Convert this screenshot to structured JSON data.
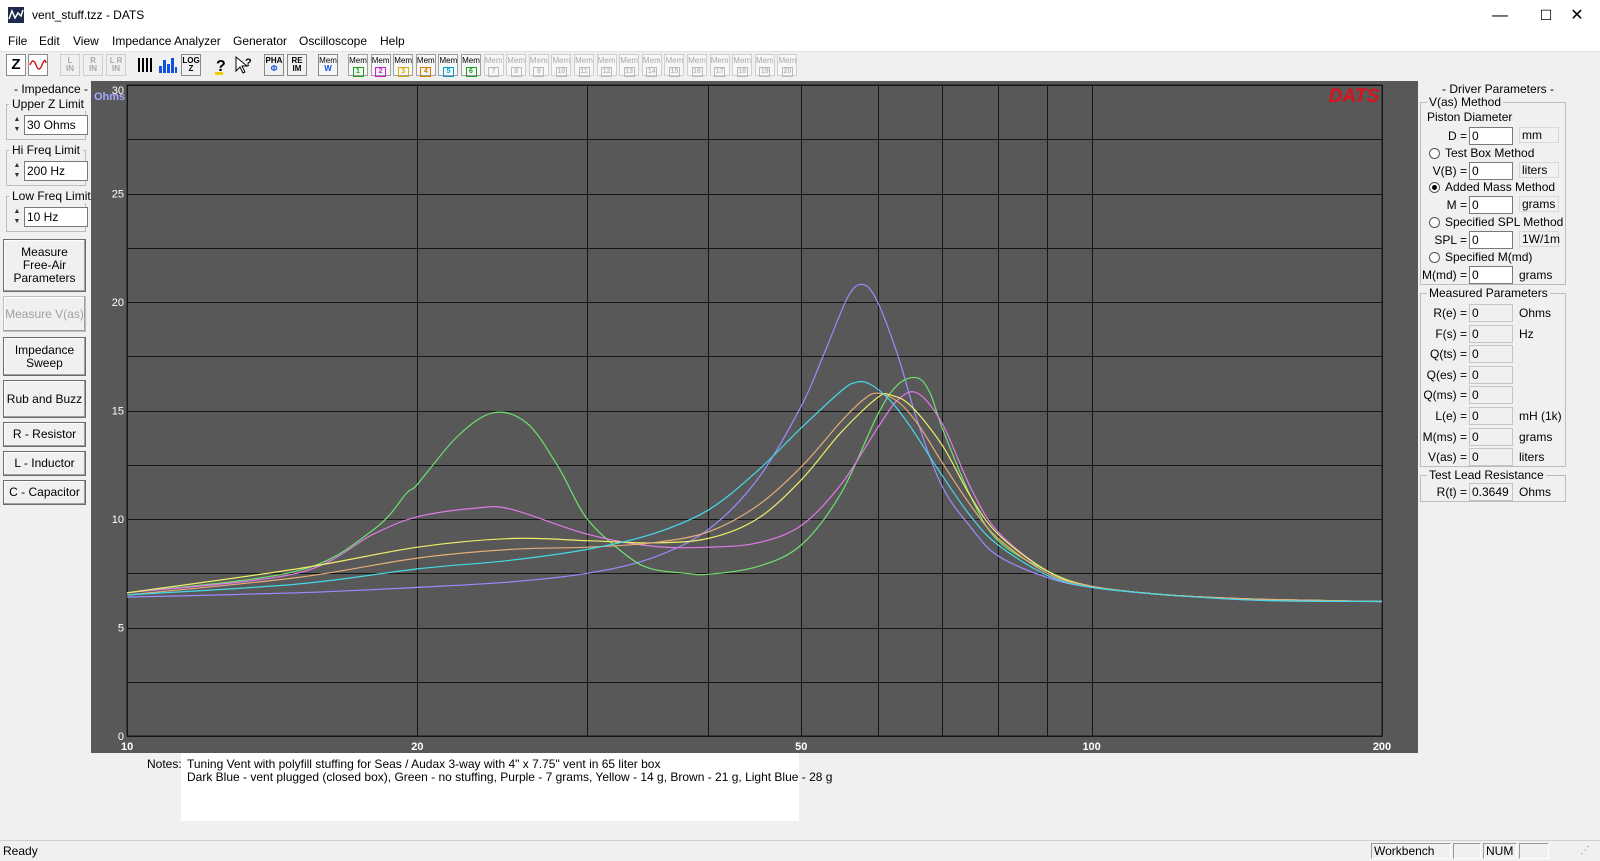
{
  "window": {
    "title": "vent_stuff.tzz - DATS",
    "minimize": "—",
    "maximize": "☐",
    "close": "✕"
  },
  "menu": [
    "File",
    "Edit",
    "View",
    "Impedance Analyzer",
    "Generator",
    "Oscilloscope",
    "Help"
  ],
  "toolbar": {
    "z_label": "Z",
    "lin_label": [
      "L",
      "IN"
    ],
    "rin_label": [
      "R",
      "IN"
    ],
    "lrin_label": [
      "L R",
      "IN"
    ],
    "log_label": [
      "LOG",
      "Z"
    ],
    "pha_label": [
      "PHA",
      "Φ"
    ],
    "reim_label": [
      "RE",
      "IM"
    ],
    "memw_label": [
      "Mem",
      "W"
    ],
    "mem_word": "Mem",
    "mem_slots": [
      {
        "n": "1",
        "color": "#1ea21e",
        "enabled": true
      },
      {
        "n": "2",
        "color": "#d01ad0",
        "enabled": true
      },
      {
        "n": "3",
        "color": "#d8b000",
        "enabled": true
      },
      {
        "n": "4",
        "color": "#d87a00",
        "enabled": true
      },
      {
        "n": "5",
        "color": "#00a0d0",
        "enabled": true
      },
      {
        "n": "6",
        "color": "#1ea21e",
        "enabled": true
      },
      {
        "n": "7",
        "enabled": false
      },
      {
        "n": "8",
        "enabled": false
      },
      {
        "n": "9",
        "enabled": false
      },
      {
        "n": "10",
        "enabled": false
      },
      {
        "n": "11",
        "enabled": false
      },
      {
        "n": "12",
        "enabled": false
      },
      {
        "n": "13",
        "enabled": false
      },
      {
        "n": "14",
        "enabled": false
      },
      {
        "n": "15",
        "enabled": false
      },
      {
        "n": "16",
        "enabled": false
      },
      {
        "n": "17",
        "enabled": false
      },
      {
        "n": "18",
        "enabled": false
      },
      {
        "n": "19",
        "enabled": false
      },
      {
        "n": "20",
        "enabled": false
      }
    ]
  },
  "left": {
    "impedance_group": "- Impedance -",
    "upper_z_label": "Upper Z Limit",
    "upper_z_value": "30 Ohms",
    "hi_freq_label": "Hi Freq Limit",
    "hi_freq_value": "200 Hz",
    "low_freq_label": "Low Freq Limit",
    "low_freq_value": "10 Hz",
    "btn_measure_free_air": [
      "Measure",
      "Free-Air",
      "Parameters"
    ],
    "btn_measure_vas": "Measure V(as)",
    "btn_impedance_sweep": [
      "Impedance",
      "Sweep"
    ],
    "btn_rub_buzz": "Rub and Buzz",
    "btn_resistor": "R - Resistor",
    "btn_inductor": "L - Inductor",
    "btn_capacitor": "C - Capacitor"
  },
  "chart_data": {
    "type": "line",
    "ylabel": "Ohms",
    "watermark": "DATS",
    "x_scale": "log",
    "xlim": [
      10,
      200
    ],
    "ylim": [
      0,
      30
    ],
    "x_ticks": [
      10,
      20,
      50,
      100,
      200
    ],
    "x_grid": [
      10,
      20,
      30,
      40,
      50,
      60,
      70,
      80,
      90,
      100,
      200
    ],
    "y_ticks": [
      0,
      5,
      10,
      15,
      20,
      25,
      30
    ],
    "y_grid_step": 2.5,
    "background": "#585858",
    "grid": true,
    "series": [
      {
        "color": "#9b8cff",
        "x": [
          10,
          15,
          20,
          25,
          30,
          35,
          40,
          45,
          50,
          53,
          56,
          58,
          60,
          63,
          66,
          70,
          75,
          80,
          90,
          100,
          120,
          150,
          200
        ],
        "y": [
          6.4,
          6.6,
          6.85,
          7.1,
          7.5,
          8.2,
          9.5,
          11.8,
          15.2,
          17.8,
          20.3,
          20.8,
          20.0,
          17.5,
          14.5,
          11.5,
          9.6,
          8.3,
          7.3,
          6.85,
          6.5,
          6.25,
          6.2
        ]
      },
      {
        "color": "#6fe06f",
        "x": [
          10,
          15,
          18,
          19.5,
          20,
          22,
          24,
          26,
          28,
          30,
          33,
          35,
          38,
          40,
          45,
          50,
          55,
          60,
          63,
          66,
          68,
          70,
          75,
          80,
          90,
          100,
          120,
          150,
          200
        ],
        "y": [
          6.6,
          7.6,
          9.5,
          11.2,
          11.6,
          13.8,
          14.9,
          14.4,
          12.4,
          10.0,
          8.3,
          7.7,
          7.5,
          7.45,
          7.8,
          8.8,
          11.2,
          14.8,
          16.2,
          16.5,
          15.8,
          14.2,
          11.0,
          9.0,
          7.6,
          6.9,
          6.5,
          6.3,
          6.2
        ]
      },
      {
        "color": "#e07ae8",
        "x": [
          10,
          15,
          18,
          20,
          23,
          25,
          30,
          35,
          40,
          45,
          50,
          55,
          60,
          63,
          66,
          70,
          75,
          80,
          90,
          100,
          120,
          150,
          200
        ],
        "y": [
          6.6,
          7.5,
          9.3,
          10.1,
          10.5,
          10.45,
          9.3,
          8.75,
          8.7,
          8.9,
          9.7,
          11.6,
          14.2,
          15.5,
          15.8,
          14.4,
          11.4,
          9.4,
          7.6,
          6.9,
          6.5,
          6.3,
          6.2
        ]
      },
      {
        "color": "#eded6a",
        "x": [
          10,
          15,
          20,
          25,
          30,
          35,
          40,
          45,
          50,
          55,
          60,
          62,
          65,
          70,
          75,
          80,
          90,
          100,
          120,
          150,
          200
        ],
        "y": [
          6.6,
          7.7,
          8.7,
          9.1,
          9.0,
          8.9,
          9.1,
          10.0,
          11.8,
          14.0,
          15.6,
          15.7,
          15.2,
          13.4,
          11.0,
          9.3,
          7.6,
          6.9,
          6.5,
          6.3,
          6.2
        ]
      },
      {
        "color": "#e2ad7a",
        "x": [
          10,
          15,
          20,
          25,
          30,
          35,
          40,
          45,
          50,
          55,
          58,
          60,
          63,
          66,
          70,
          75,
          80,
          90,
          100,
          120,
          150,
          200
        ],
        "y": [
          6.5,
          7.3,
          8.2,
          8.6,
          8.7,
          8.9,
          9.4,
          10.6,
          12.4,
          14.5,
          15.5,
          15.8,
          15.4,
          14.4,
          12.6,
          10.6,
          9.1,
          7.5,
          6.9,
          6.5,
          6.3,
          6.2
        ]
      },
      {
        "color": "#46d8e8",
        "x": [
          10,
          15,
          20,
          25,
          30,
          35,
          40,
          45,
          50,
          55,
          57,
          59,
          62,
          65,
          70,
          75,
          80,
          90,
          100,
          120,
          150,
          200
        ],
        "y": [
          6.5,
          7.0,
          7.7,
          8.1,
          8.6,
          9.3,
          10.4,
          12.2,
          14.2,
          15.9,
          16.3,
          16.2,
          15.4,
          14.2,
          12.0,
          10.1,
          8.8,
          7.4,
          6.85,
          6.5,
          6.25,
          6.2
        ]
      }
    ]
  },
  "notes": {
    "label": "Notes:",
    "line1": "Tuning Vent with polyfill stuffing for Seas / Audax 3-way with 4\" x 7.75\" vent in 65 liter box",
    "line2": "Dark Blue - vent plugged (closed box), Green - no stuffing, Purple - 7 grams, Yellow - 14 g,  Brown - 21 g, Light Blue - 28 g"
  },
  "right": {
    "driver_params_title": "- Driver Parameters -",
    "vas_method_title": "V(as) Method",
    "piston_diameter": "Piston Diameter",
    "d_label": "D =",
    "d_value": "0",
    "d_unit": "mm",
    "test_box_method": "Test Box Method",
    "vb_label": "V(B) =",
    "vb_value": "0",
    "vb_unit": "liters",
    "added_mass_method": "Added Mass Method",
    "m_label": "M =",
    "m_value": "0",
    "m_unit": "grams",
    "specified_spl_method": "Specified SPL Method",
    "spl_label": "SPL =",
    "spl_value": "0",
    "spl_unit": "1W/1m",
    "specified_mmd": "Specified M(md)",
    "mmd_label": "M(md) =",
    "mmd_value": "0",
    "mmd_unit": "grams",
    "measured_title": "Measured Parameters",
    "measured": [
      {
        "label": "R(e) =",
        "value": "0",
        "unit": "Ohms"
      },
      {
        "label": "F(s) =",
        "value": "0",
        "unit": "Hz"
      },
      {
        "label": "Q(ts) =",
        "value": "0",
        "unit": ""
      },
      {
        "label": "Q(es) =",
        "value": "0",
        "unit": ""
      },
      {
        "label": "Q(ms) =",
        "value": "0",
        "unit": ""
      },
      {
        "label": "L(e) =",
        "value": "0",
        "unit": "mH (1k)"
      },
      {
        "label": "M(ms) =",
        "value": "0",
        "unit": "grams"
      },
      {
        "label": "V(as) =",
        "value": "0",
        "unit": "liters"
      }
    ],
    "lead_title": "Test Lead Resistance",
    "lead_label": "R(t) =",
    "lead_value": "0.3649",
    "lead_unit": "Ohms"
  },
  "status": {
    "ready": "Ready",
    "workbench": "Workbench",
    "num": "NUM"
  }
}
